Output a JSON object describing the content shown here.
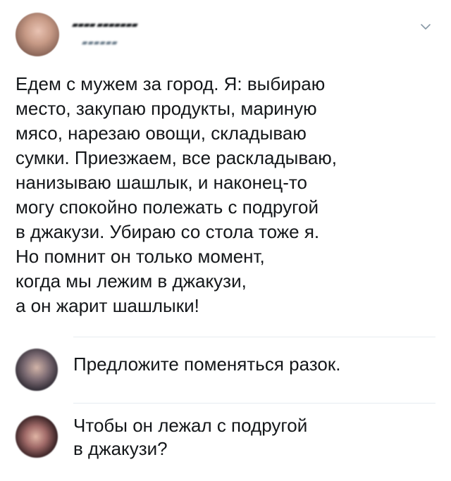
{
  "post": {
    "author_name": "▰▰▰▰ ▰▰▰▰▰▰▰",
    "author_handle": "▰▰▰▰▰▰",
    "text": "Едем с мужем за город. Я: выбираю\nместо, закупаю продукты, мариную\nмясо, нарезаю овощи, складываю\nсумки. Приезжаем, все раскладываю,\nнанизываю шашлык, и наконец-то\nмогу спокойно полежать  с подругой\nв джакузи. Убираю со стола тоже я.\nНо помнит он только момент,\nкогда мы лежим в джакузи,\nа он жарит шашлыки!",
    "menu_icon": "chevron-down-icon"
  },
  "replies": [
    {
      "text": "Предложите поменяться разок."
    },
    {
      "text": "Чтобы он лежал с подругой\nв джакузи?"
    }
  ],
  "colors": {
    "text": "#14171a",
    "secondary": "#657786",
    "divider": "#e6ecf0",
    "chevron": "#8899a6"
  }
}
